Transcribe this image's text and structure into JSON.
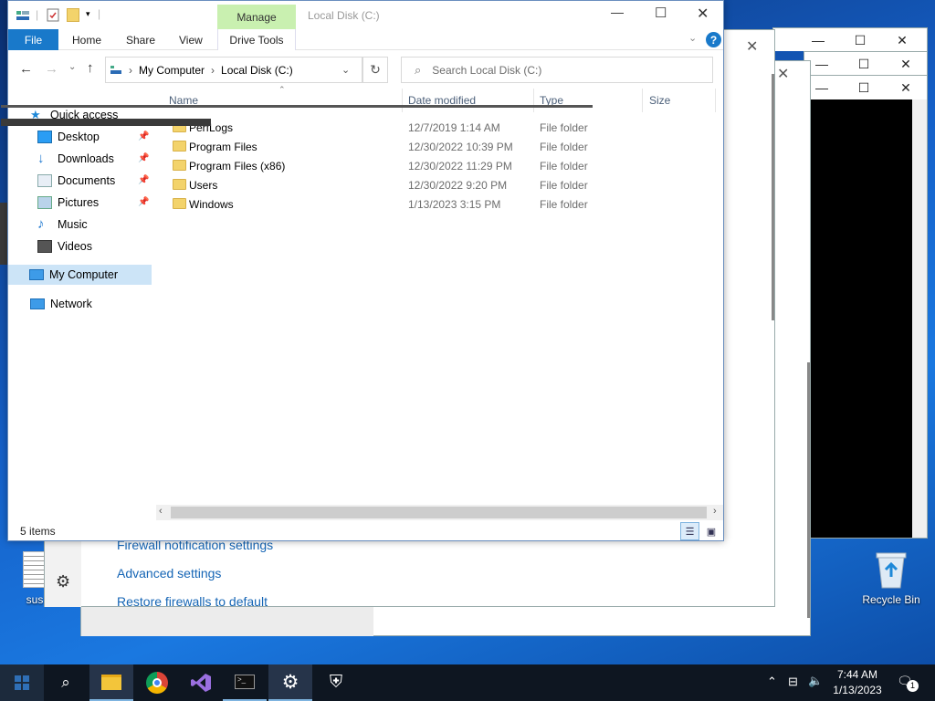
{
  "explorer": {
    "title": "Local Disk (C:)",
    "context_tab": "Manage",
    "ribbon_tabs": [
      "File",
      "Home",
      "Share",
      "View",
      "Drive Tools"
    ],
    "breadcrumb": [
      "My Computer",
      "Local Disk (C:)"
    ],
    "search_placeholder": "Search Local Disk (C:)",
    "columns": [
      "Name",
      "Date modified",
      "Type",
      "Size"
    ],
    "nav": [
      {
        "label": "Quick access",
        "icon": "star-icon",
        "pinned": false
      },
      {
        "label": "Desktop",
        "icon": "desktop-icon",
        "pinned": true
      },
      {
        "label": "Downloads",
        "icon": "download-icon",
        "pinned": true
      },
      {
        "label": "Documents",
        "icon": "documents-icon",
        "pinned": true
      },
      {
        "label": "Pictures",
        "icon": "pictures-icon",
        "pinned": true
      },
      {
        "label": "Music",
        "icon": "music-icon",
        "pinned": false
      },
      {
        "label": "Videos",
        "icon": "videos-icon",
        "pinned": false
      },
      {
        "label": "My Computer",
        "icon": "computer-icon",
        "pinned": false
      },
      {
        "label": "Network",
        "icon": "network-icon",
        "pinned": false
      }
    ],
    "files": [
      {
        "name": "PerfLogs",
        "date": "12/7/2019 1:14 AM",
        "type": "File folder"
      },
      {
        "name": "Program Files",
        "date": "12/30/2022 10:39 PM",
        "type": "File folder"
      },
      {
        "name": "Program Files (x86)",
        "date": "12/30/2022 11:29 PM",
        "type": "File folder"
      },
      {
        "name": "Users",
        "date": "12/30/2022 9:20 PM",
        "type": "File folder"
      },
      {
        "name": "Windows",
        "date": "1/13/2023 3:15 PM",
        "type": "File folder"
      }
    ],
    "status": "5 items"
  },
  "firewall": {
    "links": [
      "Firewall notification settings",
      "Advanced settings",
      "Restore firewalls to default"
    ]
  },
  "desktop": {
    "recycle_bin": "Recycle Bin",
    "file_label": "sus"
  },
  "taskbar": {
    "time": "7:44 AM",
    "date": "1/13/2023",
    "notification_count": "1"
  },
  "colors": {
    "accent": "#1979ca",
    "manage_tab": "#c9f0b0",
    "taskbar": "#0e1621"
  }
}
